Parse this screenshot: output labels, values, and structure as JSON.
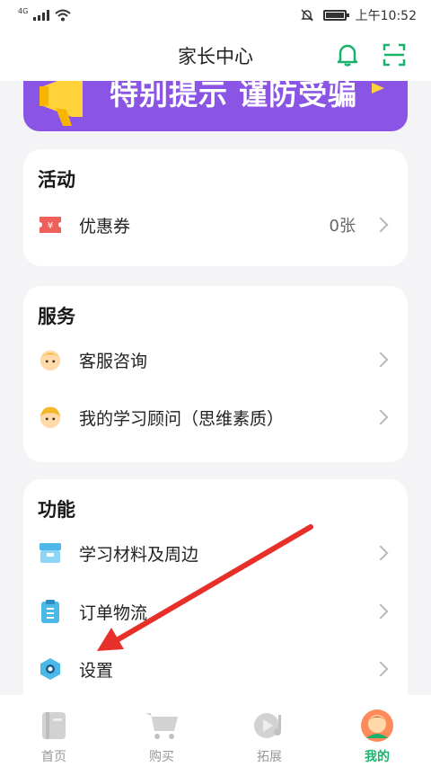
{
  "status_bar": {
    "network": "4G",
    "time": "上午10:52"
  },
  "header": {
    "title": "家长中心"
  },
  "banner": {
    "text": "特别提示 谨防受骗"
  },
  "activity": {
    "title": "活动",
    "items": [
      {
        "label": "优惠券",
        "value": "0张",
        "icon": "coupon-icon"
      }
    ]
  },
  "service": {
    "title": "服务",
    "items": [
      {
        "label": "客服咨询",
        "icon": "customer-service-avatar-icon"
      },
      {
        "label": "我的学习顾问（思维素质）",
        "icon": "advisor-avatar-icon"
      }
    ]
  },
  "function": {
    "title": "功能",
    "items": [
      {
        "label": "学习材料及周边",
        "icon": "materials-box-icon"
      },
      {
        "label": "订单物流",
        "icon": "clipboard-icon"
      },
      {
        "label": "设置",
        "icon": "settings-gear-icon"
      }
    ]
  },
  "tabbar": {
    "items": [
      {
        "label": "首页",
        "icon": "home-book-icon",
        "active": false
      },
      {
        "label": "购买",
        "icon": "cart-icon",
        "active": false
      },
      {
        "label": "拓展",
        "icon": "play-music-icon",
        "active": false
      },
      {
        "label": "我的",
        "icon": "profile-avatar-icon",
        "active": true
      }
    ]
  },
  "colors": {
    "accent": "#1ab26b",
    "banner": "#8a54e4",
    "arrow": "#e8302a"
  }
}
